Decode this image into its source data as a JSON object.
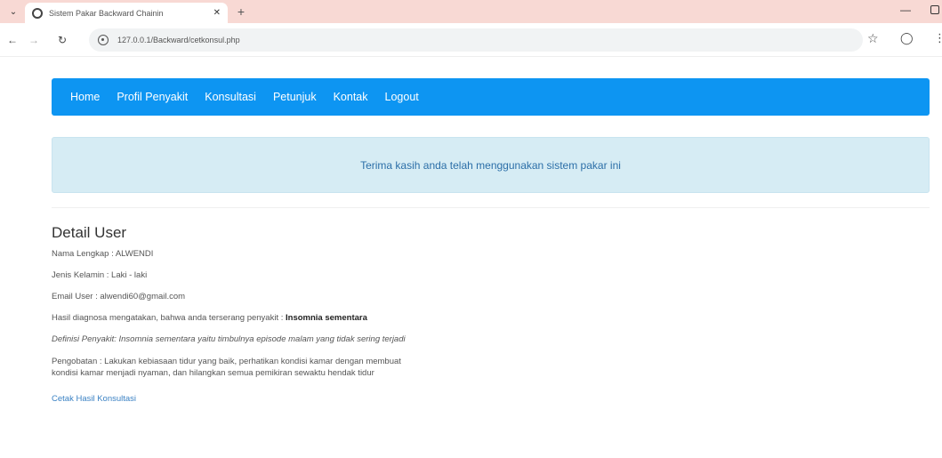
{
  "browser": {
    "tab_title": "Sistem Pakar Backward Chainin",
    "url": "127.0.0.1/Backward/cetkonsul.php"
  },
  "nav": {
    "items": [
      "Home",
      "Profil Penyakit",
      "Konsultasi",
      "Petunjuk",
      "Kontak",
      "Logout"
    ]
  },
  "alert": {
    "message": "Terima kasih anda telah menggunakan sistem pakar ini"
  },
  "detail": {
    "title": "Detail User",
    "name_line": "Nama Lengkap : ALWENDI",
    "gender_line": "Jenis Kelamin : Laki - laki",
    "email_line": "Email User : alwendi60@gmail.com",
    "diagnosis_prefix": "Hasil diagnosa mengatakan, bahwa anda terserang penyakit :",
    "diagnosis_disease": "Insomnia sementara",
    "definition": "Definisi Penyakit: Insomnia sementara yaitu timbulnya episode malam yang tidak sering terjadi",
    "solution_line1": "Pengobatan : Lakukan kebiasaan tidur yang baik, perhatikan kondisi kamar dengan membuat",
    "solution_line2": "kondisi kamar menjadi nyaman, dan hilangkan semua pemikiran sewaktu hendak tidur",
    "print_link": "Cetak Hasil Konsultasi"
  }
}
